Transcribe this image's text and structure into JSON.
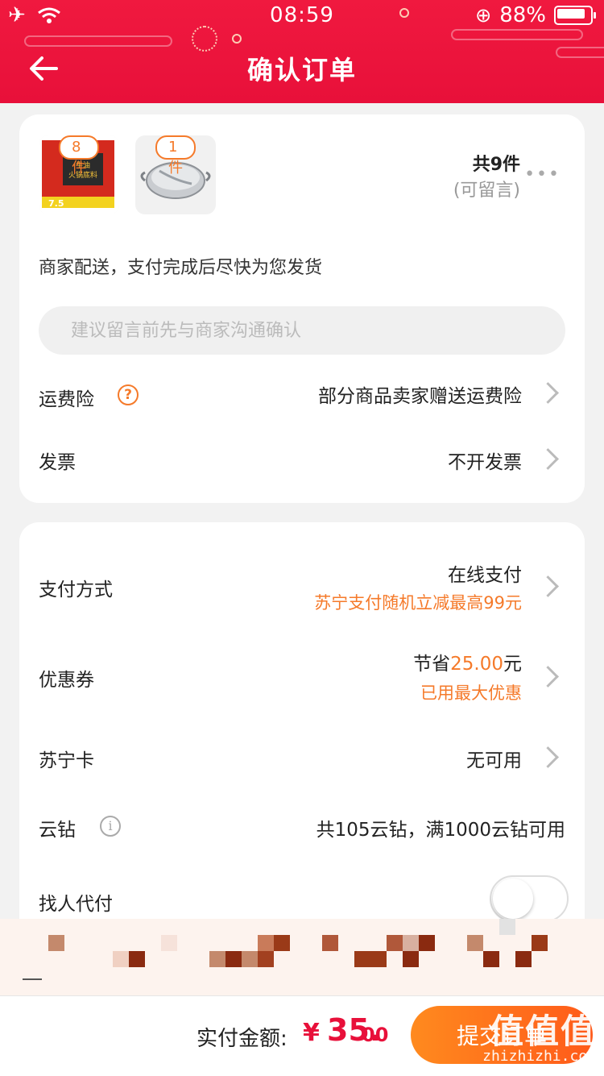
{
  "status": {
    "time": "08:59",
    "battery": "88%"
  },
  "header": {
    "title": "确认订单"
  },
  "products": [
    {
      "count": "8件"
    },
    {
      "count": "1件"
    }
  ],
  "summary": {
    "total_items": "共9件",
    "message_hint": "(可留言)",
    "more": "•••"
  },
  "delivery": "商家配送，支付完成后尽快为您发货",
  "message": {
    "placeholder": "建议留言前先与商家沟通确认"
  },
  "rows1": {
    "freight_label": "运费险",
    "freight_value": "部分商品卖家赠送运费险",
    "invoice_label": "发票",
    "invoice_value": "不开发票"
  },
  "rows2": {
    "pay_label": "支付方式",
    "pay_value": "在线支付",
    "pay_promo": "苏宁支付随机立减最高99元",
    "coupon_label": "优惠券",
    "coupon_prefix": "节省",
    "coupon_amount": "25.00",
    "coupon_suffix": "元",
    "coupon_note": "已用最大优惠",
    "card_label": "苏宁卡",
    "card_value": "无可用",
    "diamond_label": "云钻",
    "diamond_value": "共105云钻，满1000云钻可用",
    "proxy_label": "找人代付"
  },
  "footer": {
    "total_label": "实付金额:",
    "currency": "¥",
    "amount_int": "35.",
    "amount_dec": "00",
    "submit_label": "提交订单"
  },
  "watermark": {
    "big": "值值值",
    "url": "zhizhizhi.com"
  },
  "colors": {
    "brand_red": "#e8103a",
    "accent_orange": "#f57a2a",
    "submit_orange": "#ff6a1a"
  }
}
